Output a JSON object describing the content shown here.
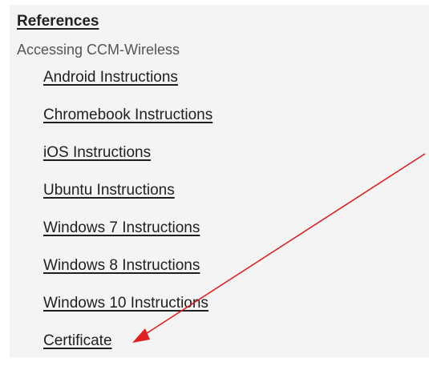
{
  "references": {
    "title": "References",
    "section_label": "Accessing CCM-Wireless",
    "links": [
      {
        "label": "Android Instructions"
      },
      {
        "label": "Chromebook Instructions"
      },
      {
        "label": "iOS Instructions"
      },
      {
        "label": "Ubuntu Instructions"
      },
      {
        "label": "Windows 7 Instructions"
      },
      {
        "label": "Windows 8 Instructions"
      },
      {
        "label": "Windows 10 Instructions"
      },
      {
        "label": "Certificate"
      }
    ]
  },
  "annotation": {
    "arrow_color": "#e02020",
    "arrow_icon": "red-arrow-icon"
  }
}
